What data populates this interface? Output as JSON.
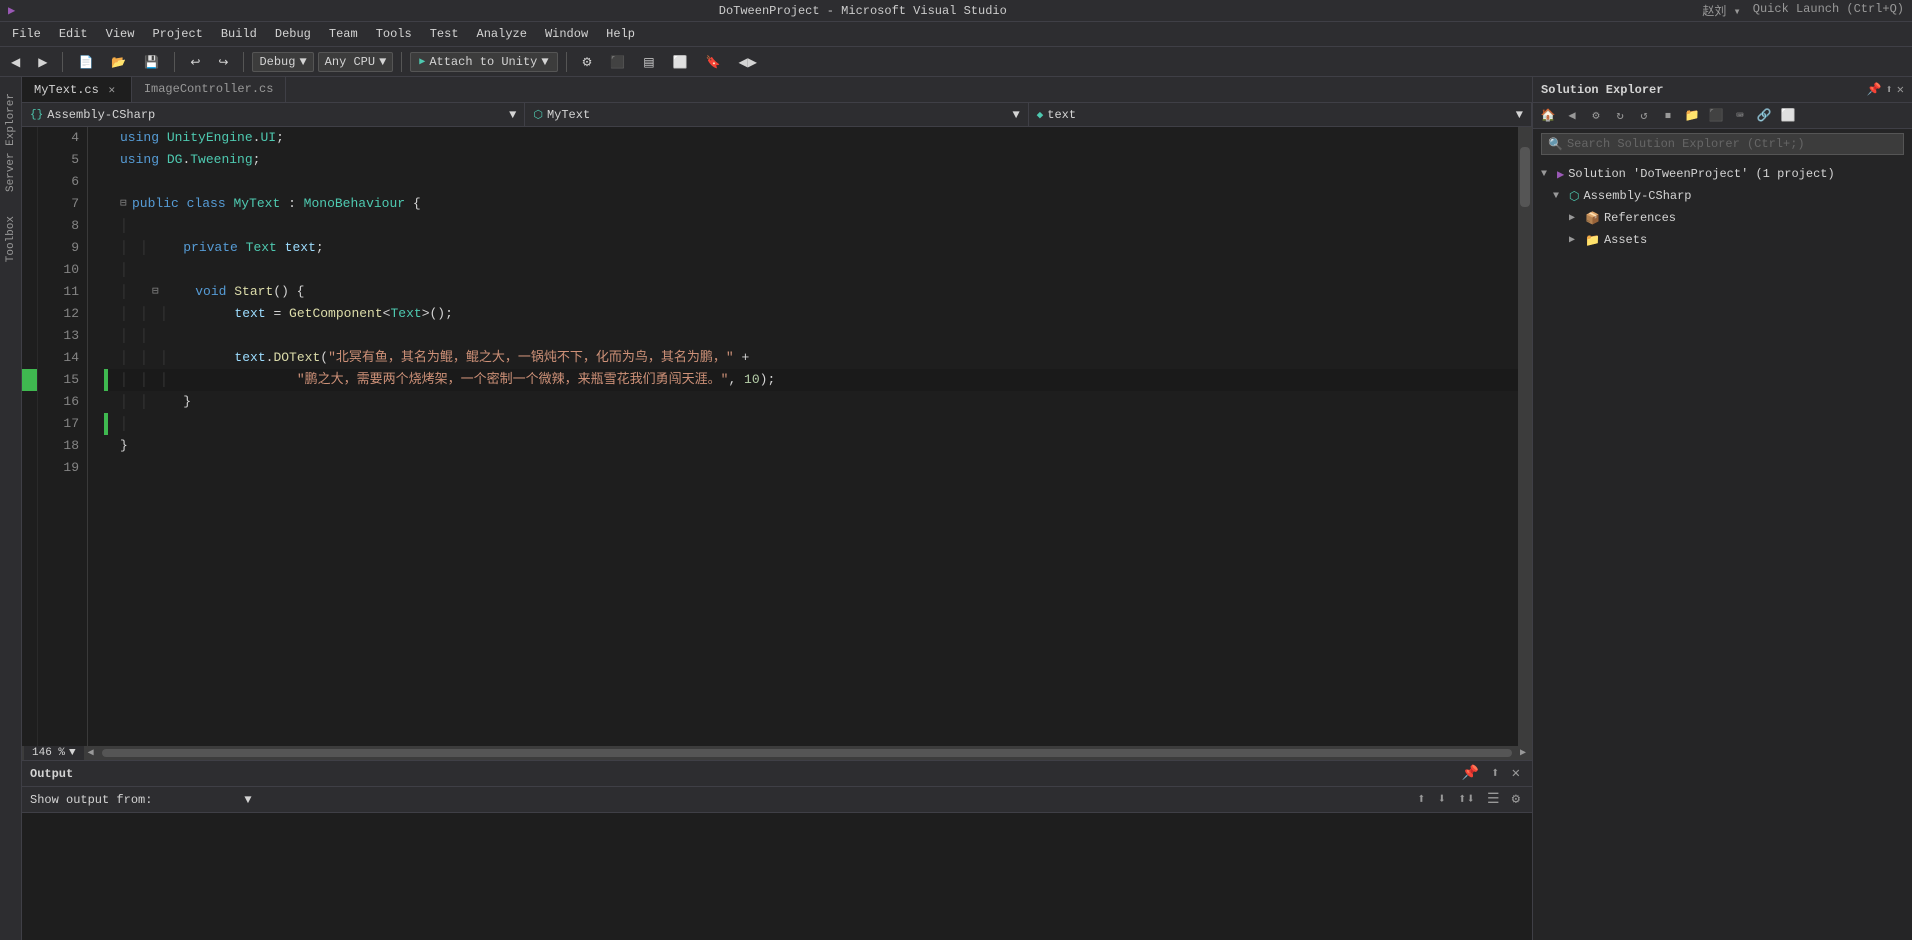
{
  "titlebar": {
    "title": "DoTweenProject - Microsoft Visual Studio",
    "icon": "VS"
  },
  "menubar": {
    "items": [
      "File",
      "Edit",
      "View",
      "Project",
      "Build",
      "Debug",
      "Team",
      "Tools",
      "Test",
      "Analyze",
      "Window",
      "Help"
    ]
  },
  "toolbar": {
    "debug_config": "Debug",
    "platform": "Any CPU",
    "attach_label": "Attach to Unity",
    "arrow": "▼"
  },
  "tabs": [
    {
      "label": "MyText.cs",
      "active": true,
      "modified": false
    },
    {
      "label": "ImageController.cs",
      "active": false,
      "modified": false
    }
  ],
  "nav_bar": {
    "namespace": "Assembly-CSharp",
    "class": "MyText",
    "member": "text"
  },
  "code": {
    "lines": [
      {
        "num": 4,
        "indent": 1,
        "content": "using UnityEngine.UI;"
      },
      {
        "num": 5,
        "indent": 1,
        "content": "using DG.Tweening;"
      },
      {
        "num": 6,
        "indent": 0,
        "content": ""
      },
      {
        "num": 7,
        "indent": 1,
        "content": "public class MyText : MonoBehaviour {",
        "collapsible": true
      },
      {
        "num": 8,
        "indent": 0,
        "content": ""
      },
      {
        "num": 9,
        "indent": 2,
        "content": "    private Text text;"
      },
      {
        "num": 10,
        "indent": 0,
        "content": ""
      },
      {
        "num": 11,
        "indent": 2,
        "content": "    void Start() {",
        "collapsible": true
      },
      {
        "num": 12,
        "indent": 3,
        "content": "        text = GetComponent<Text>();"
      },
      {
        "num": 13,
        "indent": 0,
        "content": ""
      },
      {
        "num": 14,
        "indent": 3,
        "content": "        text.DOText(\"北冥有鱼，其名为鲲，鲲之大，一锅炖不下，化而为鸟，其名为鹏，\" +"
      },
      {
        "num": 15,
        "indent": 3,
        "content": "                \"鹏之大，需要两个烧烤架，一个密制一个微辣，来瓶雪花我们勇闯天涯。\", 10);"
      },
      {
        "num": 16,
        "indent": 2,
        "content": "    }"
      },
      {
        "num": 17,
        "indent": 0,
        "content": ""
      },
      {
        "num": 18,
        "indent": 1,
        "content": "}"
      },
      {
        "num": 19,
        "indent": 0,
        "content": ""
      }
    ]
  },
  "zoom": "146 %",
  "output": {
    "title": "Output",
    "show_label": "Show output from:",
    "dropdown_value": ""
  },
  "solution_explorer": {
    "title": "Solution Explorer",
    "search_placeholder": "Search Solution Explorer (Ctrl+;)",
    "tree": [
      {
        "level": 0,
        "label": "Solution 'DoTweenProject' (1 project)",
        "icon": "solution",
        "expanded": true
      },
      {
        "level": 1,
        "label": "Assembly-CSharp",
        "icon": "project",
        "expanded": true
      },
      {
        "level": 2,
        "label": "References",
        "icon": "folder",
        "expanded": false
      },
      {
        "level": 2,
        "label": "Assets",
        "icon": "folder",
        "expanded": false
      }
    ]
  }
}
